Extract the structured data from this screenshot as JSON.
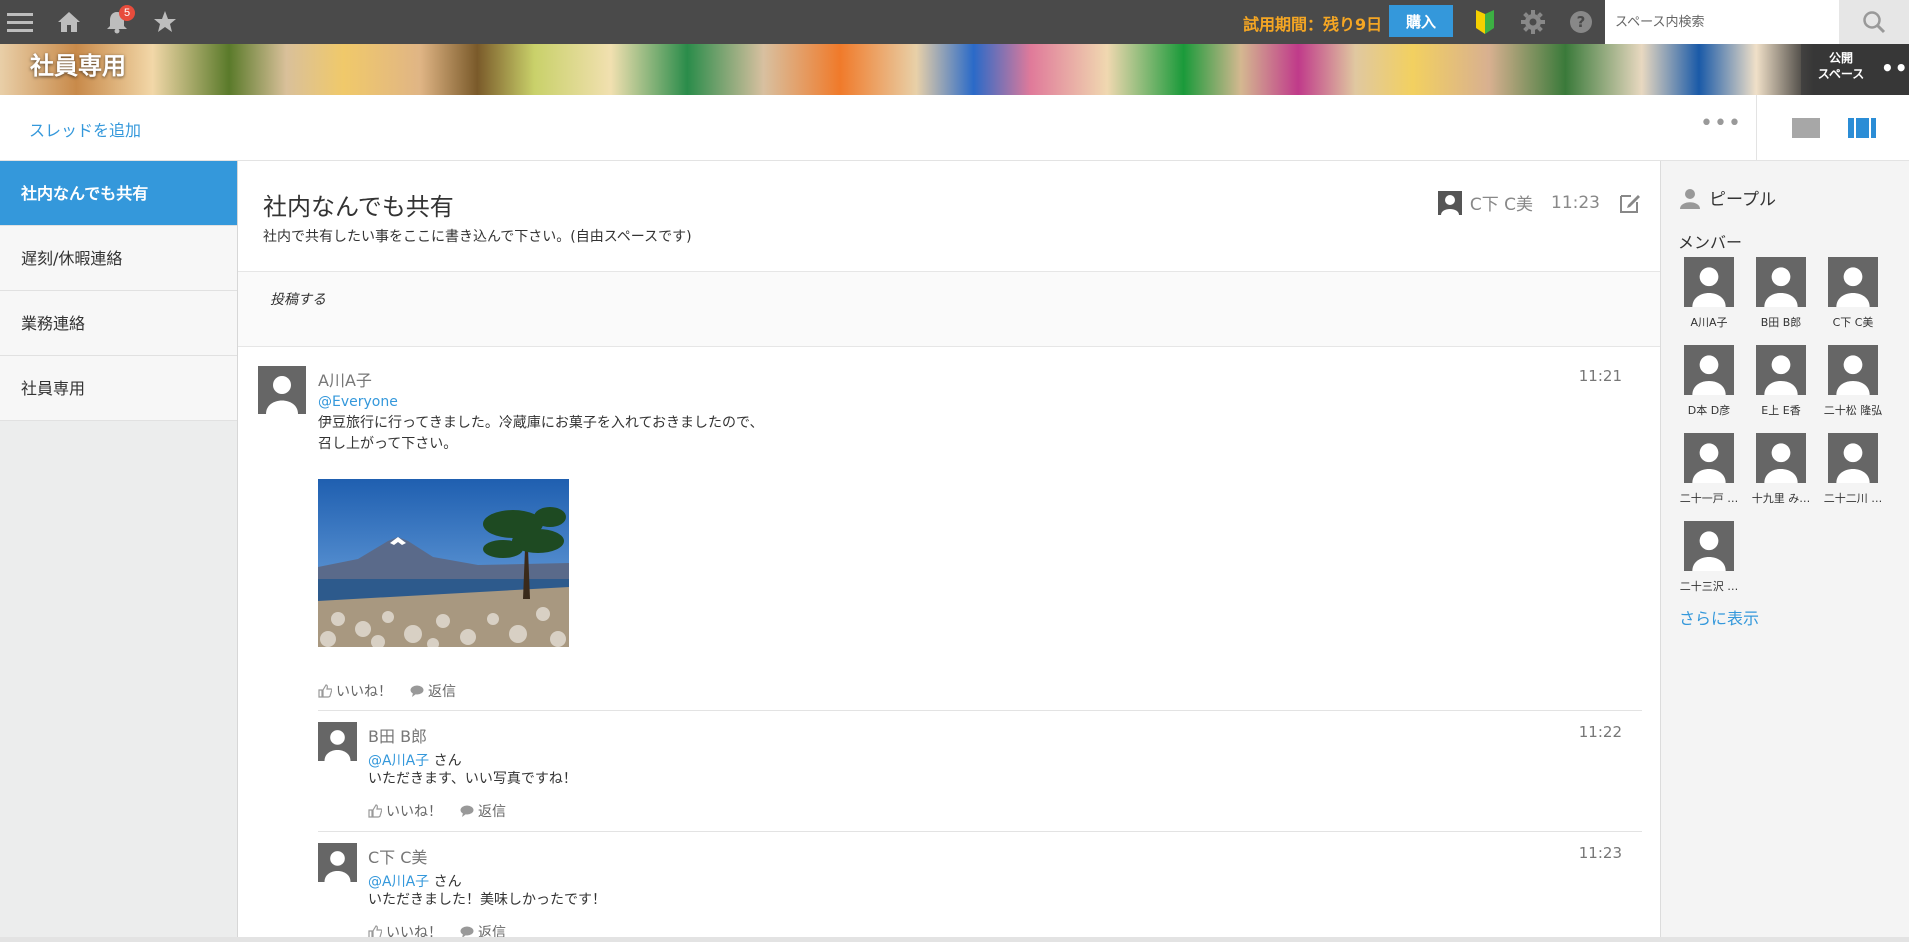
{
  "topbar": {
    "notification_count": "5",
    "trial_text": "試用期間：残り9日",
    "buy_label": "購入",
    "search_placeholder": "スペース内検索",
    "icons": [
      "menu-icon",
      "home-icon",
      "bell-icon",
      "star-icon",
      "beginner-icon",
      "gear-icon",
      "help-icon",
      "search-icon"
    ]
  },
  "banner": {
    "space_title": "社員専用",
    "public_label_1": "公開",
    "public_label_2": "スペース"
  },
  "threadbar": {
    "add_thread": "スレッドを追加"
  },
  "sidebar": {
    "items": [
      {
        "label": "社内なんでも共有",
        "active": true
      },
      {
        "label": "遅刻/休暇連絡",
        "active": false
      },
      {
        "label": "業務連絡",
        "active": false
      },
      {
        "label": "社員専用",
        "active": false
      }
    ]
  },
  "thread": {
    "title": "社内なんでも共有",
    "description": "社内で共有したい事をここに書き込んで下さい。(自由スペースです)",
    "updated_by": "C下 C美",
    "updated_time": "11:23",
    "post_placeholder": "投稿する"
  },
  "posts": [
    {
      "author": "A川A子",
      "time": "11:21",
      "mention": "@Everyone",
      "body_line1": "伊豆旅行に行ってきました。冷蔵庫にお菓子を入れておきましたので、",
      "body_line2": "召し上がって下さい。",
      "like": "いいね！",
      "reply": "返信"
    },
    {
      "author": "B田 B郎",
      "time": "11:22",
      "mention": "@A川A子",
      "san": "さん",
      "body": "いただきます、いい写真ですね！",
      "like": "いいね！",
      "reply": "返信"
    },
    {
      "author": "C下 C美",
      "time": "11:23",
      "mention": "@A川A子",
      "san": "さん",
      "body": "いただきました！美味しかったです！",
      "like": "いいね！",
      "reply": "返信"
    }
  ],
  "people": {
    "header": "ピープル",
    "members_label": "メンバー",
    "members": [
      "A川A子",
      "B田 B郎",
      "C下 C美",
      "D本 D彦",
      "E上 E香",
      "二十松 隆弘",
      "二十一戸 …",
      "十九里 み…",
      "二十二川 …",
      "二十三沢 …"
    ],
    "show_more": "さらに表示"
  },
  "colors": {
    "topbar": "#4a4a4a",
    "accent": "#3498db",
    "trial": "#f5a623"
  }
}
